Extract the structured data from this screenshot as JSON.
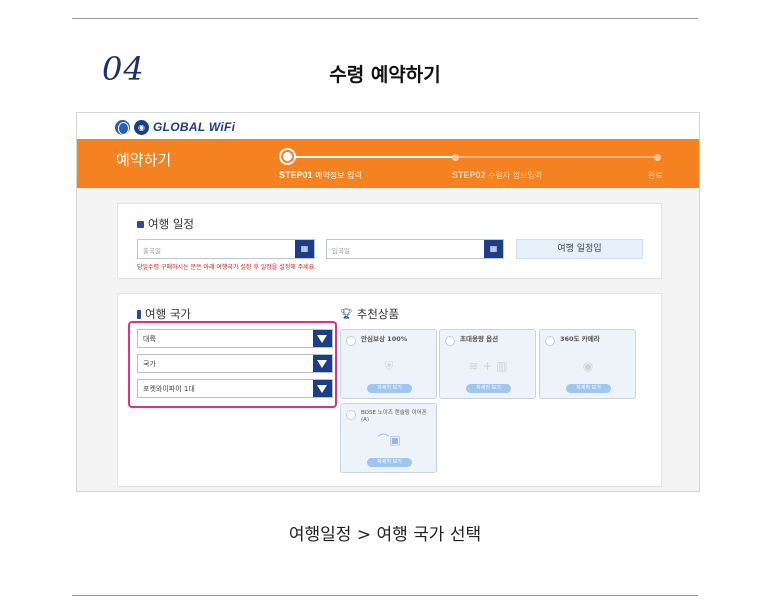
{
  "header": {
    "step_number": "04",
    "title": "수령 예약하기"
  },
  "app": {
    "logo_text": "GLOBAL WiFi",
    "banner_title": "예약하기",
    "steps": [
      {
        "code": "STEP01",
        "label": "예약정보 입력",
        "state": "active"
      },
      {
        "code": "STEP02",
        "label": "수령자 정보입력",
        "state": "upcoming"
      },
      {
        "code": "",
        "label": "완료",
        "state": "upcoming"
      }
    ],
    "colors": {
      "brand_orange": "#f58220",
      "brand_navy": "#1c3e86",
      "highlight_pink": "#e0317d",
      "warning_red": "#d81b1b"
    }
  },
  "schedule": {
    "title": "여행 일정",
    "departure_placeholder": "출국일",
    "arrival_placeholder": "입국일",
    "calendar_icon": "calendar-icon",
    "set_button": "여행 일정입",
    "warning": "당일수령 구매하시는 분은 아래 여행국가 설정 후 일정을 설정해 주세요."
  },
  "country": {
    "title": "여행 국가",
    "selects": [
      {
        "value": "대륙"
      },
      {
        "value": "국가"
      },
      {
        "value": "포켓와이파이 1대"
      }
    ]
  },
  "recommend": {
    "title": "추천상품",
    "items": [
      {
        "name": "안심보상 100%",
        "icon": "shield-icon",
        "detail": "자세히 보기"
      },
      {
        "name": "초대용량 옵션",
        "icon": "wifi-battery-icon",
        "detail": "자세히 보기"
      },
      {
        "name": "360도 카메라",
        "icon": "camera-icon",
        "detail": "자세히 보기"
      },
      {
        "name": "BOSE 노이즈 캔슬링 이어폰 (A)",
        "icon": "earphone-icon",
        "detail": "자세히 보기"
      }
    ]
  },
  "caption": "여행일정 > 여행 국가 선택"
}
